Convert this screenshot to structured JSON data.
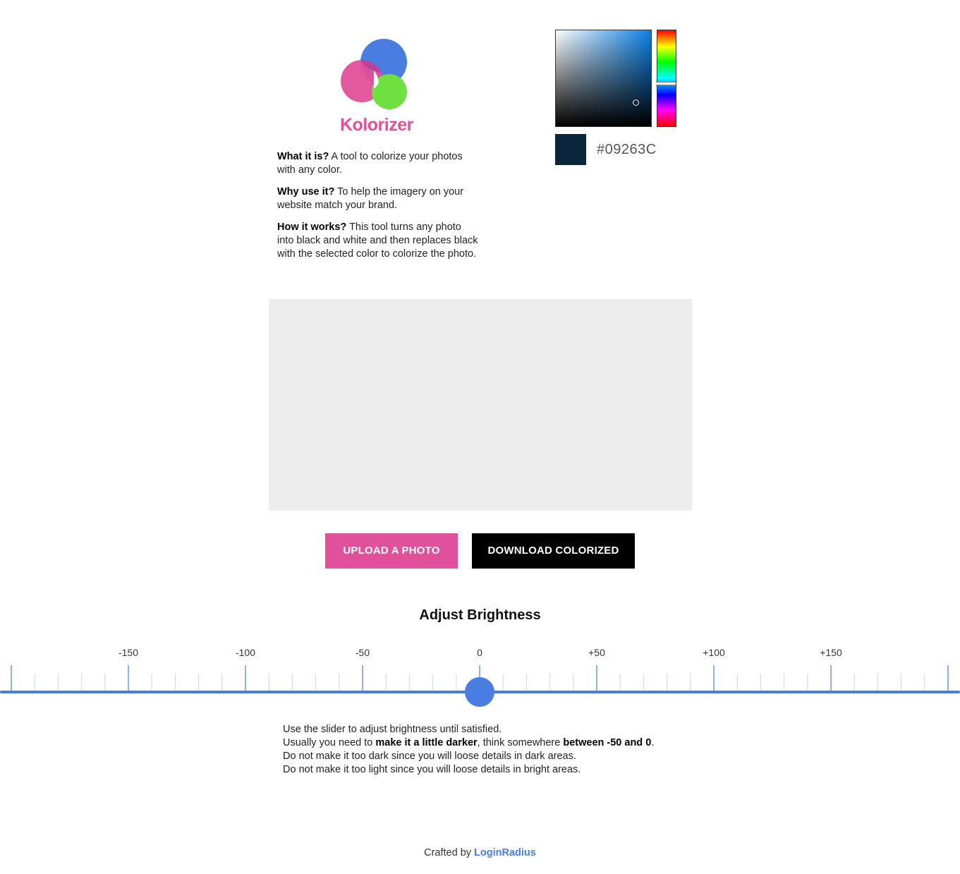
{
  "brand": {
    "name": "Kolorizer",
    "colors": {
      "blue": "#4a7de0",
      "pink": "#e1509a",
      "green": "#6ee040"
    }
  },
  "description": [
    {
      "label": "What it is?",
      "text": " A tool to colorize your photos with any color."
    },
    {
      "label": "Why use it?",
      "text": " To help the imagery on your website match your brand."
    },
    {
      "label": "How it works?",
      "text": " This tool turns any photo into black and white and then replaces black with the selected color to colorize the photo."
    }
  ],
  "color_picker": {
    "hex": "#09263C",
    "hue_color": "#0b80e6"
  },
  "buttons": {
    "upload": "UPLOAD A PHOTO",
    "download": "DOWNLOAD COLORIZED"
  },
  "brightness": {
    "title": "Adjust Brightness",
    "value": 0,
    "tick_labels": [
      "-150",
      "-100",
      "-50",
      "0",
      "+50",
      "+100",
      "+150"
    ],
    "hint": {
      "line1": "Use the slider to adjust brightness until satisfied.",
      "line2_pre": "Usually you need to ",
      "line2_bold1": "make it a little darker",
      "line2_mid": ", think somewhere ",
      "line2_bold2": "between -50 and 0",
      "line2_post": ".",
      "line3": "Do not make it too dark since you will loose details in dark areas.",
      "line4": "Do not make it too light since you will loose details in bright areas."
    }
  },
  "footer": {
    "prefix": "Crafted by ",
    "link": "LoginRadius"
  }
}
